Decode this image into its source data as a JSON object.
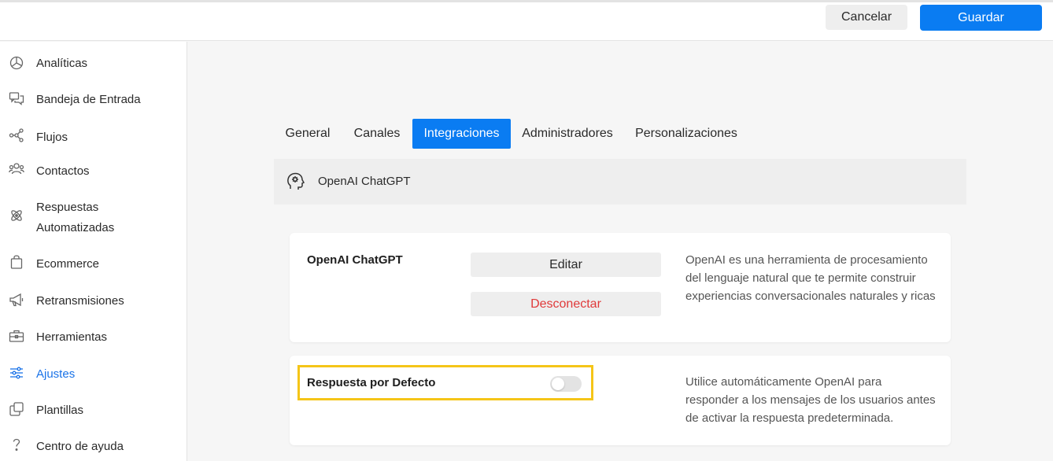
{
  "header": {
    "cancel_label": "Cancelar",
    "save_label": "Guardar"
  },
  "sidebar": {
    "items": [
      {
        "label": "Analíticas",
        "icon": "pie-chart-icon"
      },
      {
        "label": "Bandeja de Entrada",
        "icon": "chat-bubbles-icon"
      },
      {
        "label": "Flujos",
        "icon": "flow-nodes-icon"
      },
      {
        "label": "Contactos",
        "icon": "users-icon"
      },
      {
        "label": "Respuestas",
        "label2": "Automatizadas",
        "icon": "atom-icon"
      },
      {
        "label": "Ecommerce",
        "icon": "shopping-bag-icon"
      },
      {
        "label": "Retransmisiones",
        "icon": "megaphone-icon"
      },
      {
        "label": "Herramientas",
        "icon": "toolbox-icon"
      },
      {
        "label": "Ajustes",
        "icon": "sliders-icon",
        "active": true
      },
      {
        "label": "Plantillas",
        "icon": "copy-icon"
      },
      {
        "label": "Centro de ayuda",
        "icon": "question-icon"
      }
    ]
  },
  "tabs": [
    {
      "label": "General"
    },
    {
      "label": "Canales"
    },
    {
      "label": "Integraciones",
      "active": true
    },
    {
      "label": "Administradores"
    },
    {
      "label": "Personalizaciones"
    }
  ],
  "integration": {
    "header_title": "OpenAI ChatGPT",
    "card1": {
      "title": "OpenAI ChatGPT",
      "edit_label": "Editar",
      "disconnect_label": "Desconectar",
      "description": "OpenAI es una herramienta de procesamiento del lenguaje natural que te permite construir experiencias conversacionales naturales y ricas"
    },
    "card2": {
      "title": "Respuesta por Defecto",
      "toggle_on": false,
      "description": "Utilice automáticamente OpenAI para responder a los mensajes de los usuarios antes de activar la respuesta predeterminada."
    }
  },
  "colors": {
    "accent": "#0a7cf2",
    "danger": "#e03a3a",
    "highlight": "#f5c518"
  }
}
